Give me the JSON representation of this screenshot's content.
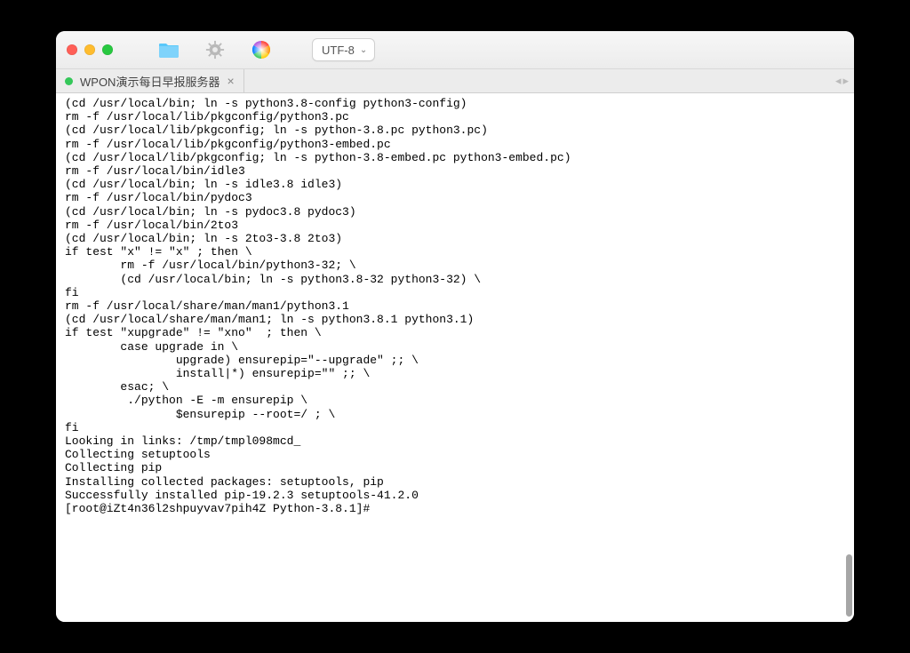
{
  "window": {
    "traffic": {
      "close": "close",
      "min": "minimize",
      "zoom": "zoom"
    }
  },
  "toolbar": {
    "folder_tooltip": "Open",
    "settings_tooltip": "Settings",
    "color_tooltip": "Color",
    "encoding_label": "UTF-8"
  },
  "tabs": {
    "items": [
      {
        "title": "WPON演示每日早报服务器",
        "status": "connected"
      }
    ]
  },
  "terminal": {
    "prompt": "[root@iZt4n36l2shpuyvav7pih4Z Python-3.8.1]#",
    "lines": [
      "(cd /usr/local/bin; ln -s python3.8-config python3-config)",
      "rm -f /usr/local/lib/pkgconfig/python3.pc",
      "(cd /usr/local/lib/pkgconfig; ln -s python-3.8.pc python3.pc)",
      "rm -f /usr/local/lib/pkgconfig/python3-embed.pc",
      "(cd /usr/local/lib/pkgconfig; ln -s python-3.8-embed.pc python3-embed.pc)",
      "rm -f /usr/local/bin/idle3",
      "(cd /usr/local/bin; ln -s idle3.8 idle3)",
      "rm -f /usr/local/bin/pydoc3",
      "(cd /usr/local/bin; ln -s pydoc3.8 pydoc3)",
      "rm -f /usr/local/bin/2to3",
      "(cd /usr/local/bin; ln -s 2to3-3.8 2to3)",
      "if test \"x\" != \"x\" ; then \\",
      "        rm -f /usr/local/bin/python3-32; \\",
      "        (cd /usr/local/bin; ln -s python3.8-32 python3-32) \\",
      "fi",
      "rm -f /usr/local/share/man/man1/python3.1",
      "(cd /usr/local/share/man/man1; ln -s python3.8.1 python3.1)",
      "if test \"xupgrade\" != \"xno\"  ; then \\",
      "        case upgrade in \\",
      "                upgrade) ensurepip=\"--upgrade\" ;; \\",
      "                install|*) ensurepip=\"\" ;; \\",
      "        esac; \\",
      "         ./python -E -m ensurepip \\",
      "                $ensurepip --root=/ ; \\",
      "fi",
      "Looking in links: /tmp/tmpl098mcd_",
      "Collecting setuptools",
      "Collecting pip",
      "Installing collected packages: setuptools, pip",
      "Successfully installed pip-19.2.3 setuptools-41.2.0",
      "[root@iZt4n36l2shpuyvav7pih4Z Python-3.8.1]#"
    ]
  }
}
